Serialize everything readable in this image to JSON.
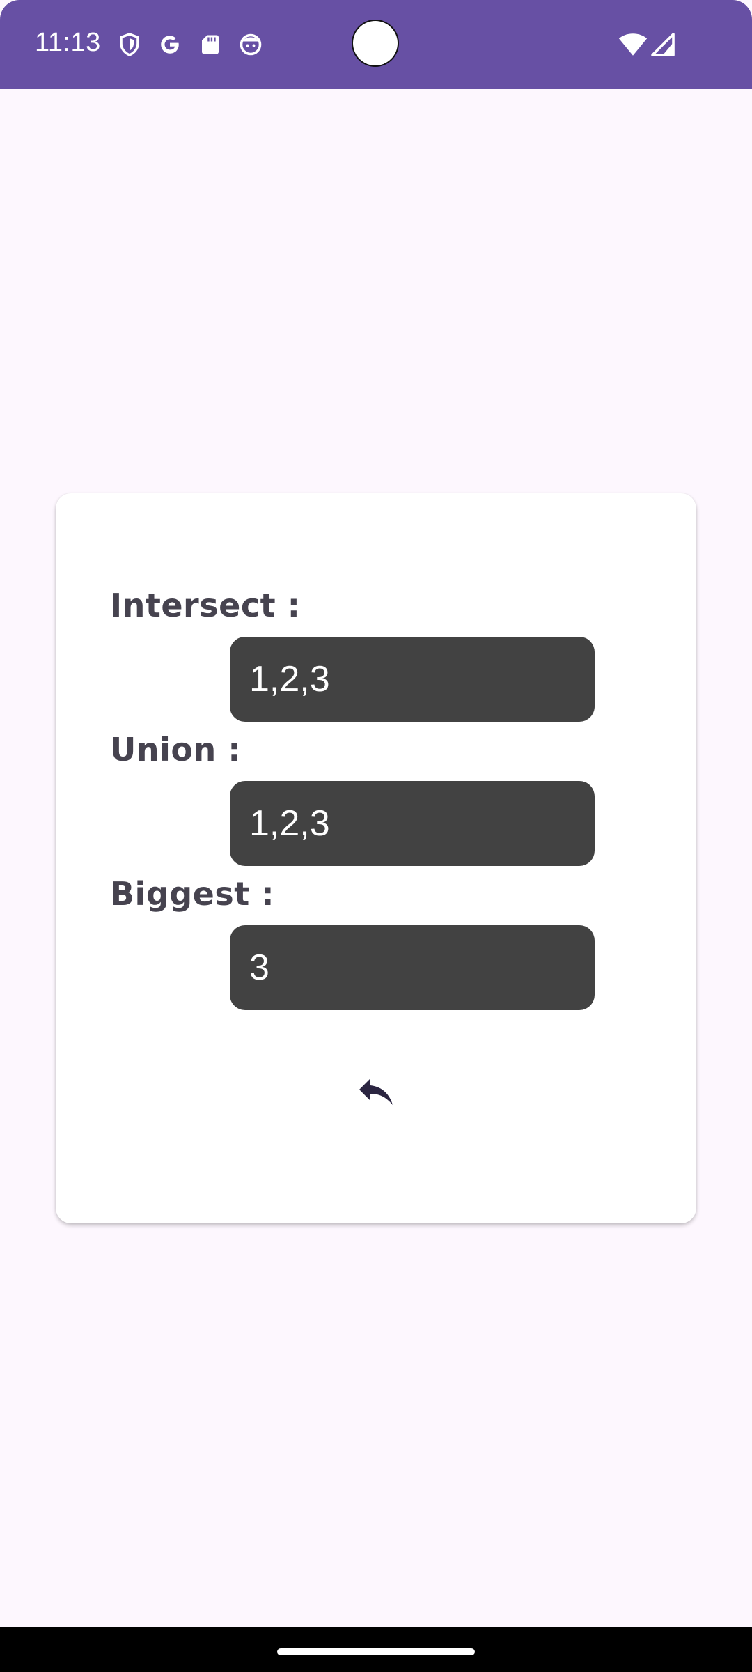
{
  "status_bar": {
    "time": "11:13",
    "icons": [
      "shield-icon",
      "google-icon",
      "sd-card-icon",
      "face-icon",
      "wifi-icon",
      "signal-icon"
    ],
    "background_color": "#6750A4"
  },
  "card": {
    "fields": [
      {
        "label": "Intersect :",
        "value": "1,2,3"
      },
      {
        "label": "Union :",
        "value": "1,2,3"
      },
      {
        "label": "Biggest :",
        "value": "3"
      }
    ],
    "back_icon": "reply-arrow-icon",
    "value_box_color": "#424242",
    "label_color": "#46434F"
  },
  "nav_bar": {
    "home_indicator": "home-indicator"
  }
}
